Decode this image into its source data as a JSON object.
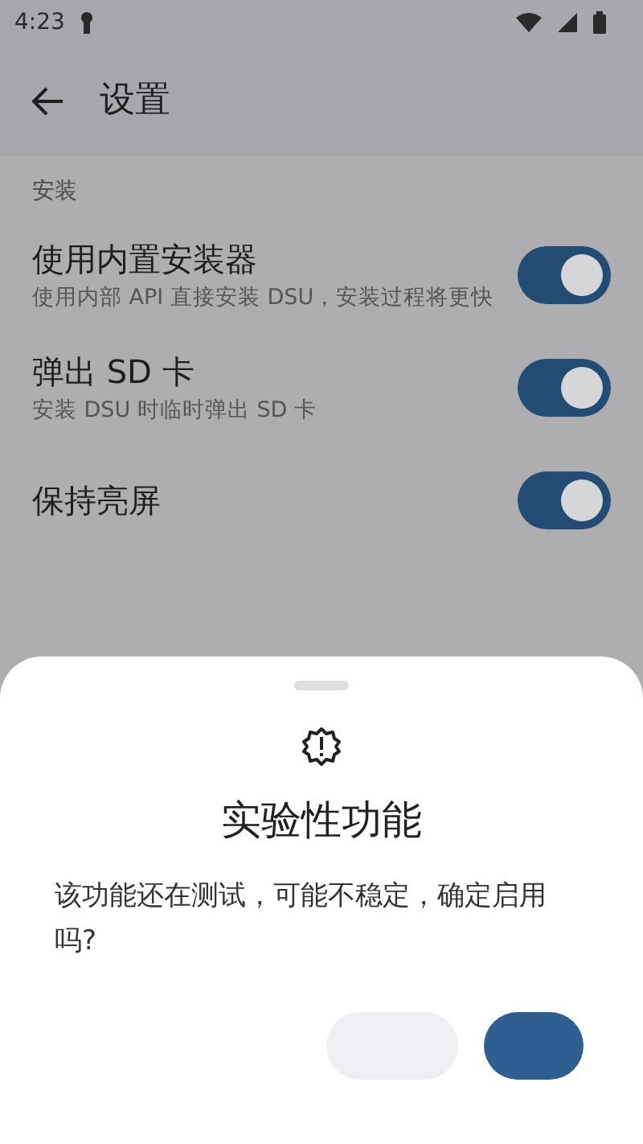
{
  "status_bar": {
    "time": "4:23"
  },
  "toolbar": {
    "title": "设置"
  },
  "section": {
    "title": "安装"
  },
  "settings": [
    {
      "title": "使用内置安装器",
      "subtitle": "使用内部 API 直接安装 DSU，安装过程将更快",
      "on": true
    },
    {
      "title": "弹出 SD 卡",
      "subtitle": "安装 DSU 时临时弹出 SD 卡",
      "on": true
    },
    {
      "title": "保持亮屏",
      "on": true
    }
  ],
  "dialog": {
    "title": "实验性功能",
    "message": "该功能还在测试，可能不稳定，确定启用吗?"
  }
}
